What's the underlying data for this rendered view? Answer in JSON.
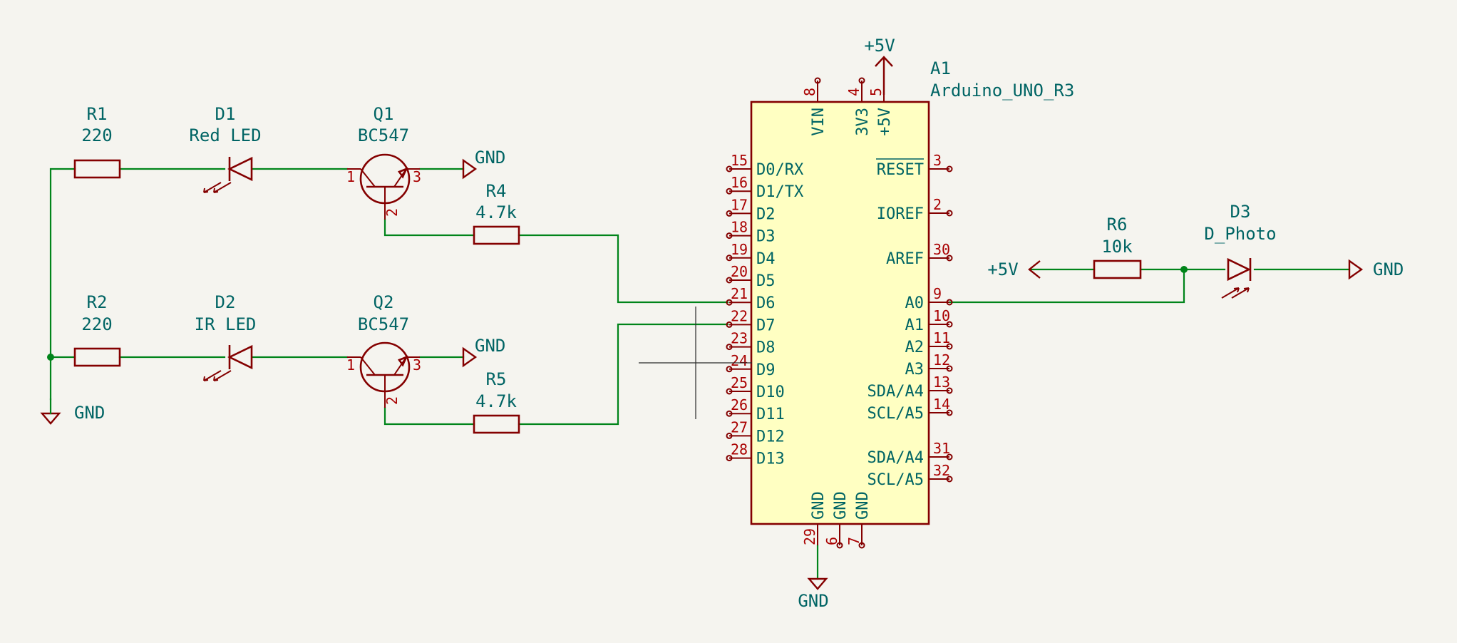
{
  "colors": {
    "background": "#f5f4ef",
    "wire": "#00841a",
    "component": "#840000",
    "label": "#006464",
    "pin_number": "#a90000",
    "ic_body": "#ffffc2"
  },
  "components": {
    "R1": {
      "ref": "R1",
      "value": "220"
    },
    "R2": {
      "ref": "R2",
      "value": "220"
    },
    "R4": {
      "ref": "R4",
      "value": "4.7k"
    },
    "R5": {
      "ref": "R5",
      "value": "4.7k"
    },
    "R6": {
      "ref": "R6",
      "value": "10k"
    },
    "D1": {
      "ref": "D1",
      "value": "Red LED"
    },
    "D2": {
      "ref": "D2",
      "value": "IR LED"
    },
    "D3": {
      "ref": "D3",
      "value": "D_Photo"
    },
    "Q1": {
      "ref": "Q1",
      "value": "BC547",
      "pins": {
        "b": "1",
        "e": "3",
        "c": "2"
      }
    },
    "Q2": {
      "ref": "Q2",
      "value": "BC547",
      "pins": {
        "b": "1",
        "e": "3",
        "c": "2"
      }
    },
    "A1": {
      "ref": "A1",
      "value": "Arduino_UNO_R3"
    }
  },
  "power": {
    "gnd": "GND",
    "vcc": "+5V"
  },
  "arduino": {
    "top_pins": [
      {
        "name": "VIN",
        "num": "8"
      },
      {
        "name": "3V3",
        "num": "4"
      },
      {
        "name": "+5V",
        "num": "5"
      }
    ],
    "bottom_pins": [
      {
        "name": "GND",
        "num": "29"
      },
      {
        "name": "GND",
        "num": "6"
      },
      {
        "name": "GND",
        "num": "7"
      }
    ],
    "left_pins": [
      {
        "name": "D0/RX",
        "num": "15"
      },
      {
        "name": "D1/TX",
        "num": "16"
      },
      {
        "name": "D2",
        "num": "17"
      },
      {
        "name": "D3",
        "num": "18"
      },
      {
        "name": "D4",
        "num": "19"
      },
      {
        "name": "D5",
        "num": "20"
      },
      {
        "name": "D6",
        "num": "21"
      },
      {
        "name": "D7",
        "num": "22"
      },
      {
        "name": "D8",
        "num": "23"
      },
      {
        "name": "D9",
        "num": "24"
      },
      {
        "name": "D10",
        "num": "25"
      },
      {
        "name": "D11",
        "num": "26"
      },
      {
        "name": "D12",
        "num": "27"
      },
      {
        "name": "D13",
        "num": "28"
      }
    ],
    "right_pins": [
      {
        "name": "RESET",
        "num": "3"
      },
      {
        "name": "IOREF",
        "num": "2"
      },
      {
        "name": "AREF",
        "num": "30"
      },
      {
        "name": "A0",
        "num": "9"
      },
      {
        "name": "A1",
        "num": "10"
      },
      {
        "name": "A2",
        "num": "11"
      },
      {
        "name": "A3",
        "num": "12"
      },
      {
        "name": "SDA/A4",
        "num": "13"
      },
      {
        "name": "SCL/A5",
        "num": "14"
      },
      {
        "name": "SDA/A4",
        "num": "31"
      },
      {
        "name": "SCL/A5",
        "num": "32"
      }
    ]
  }
}
